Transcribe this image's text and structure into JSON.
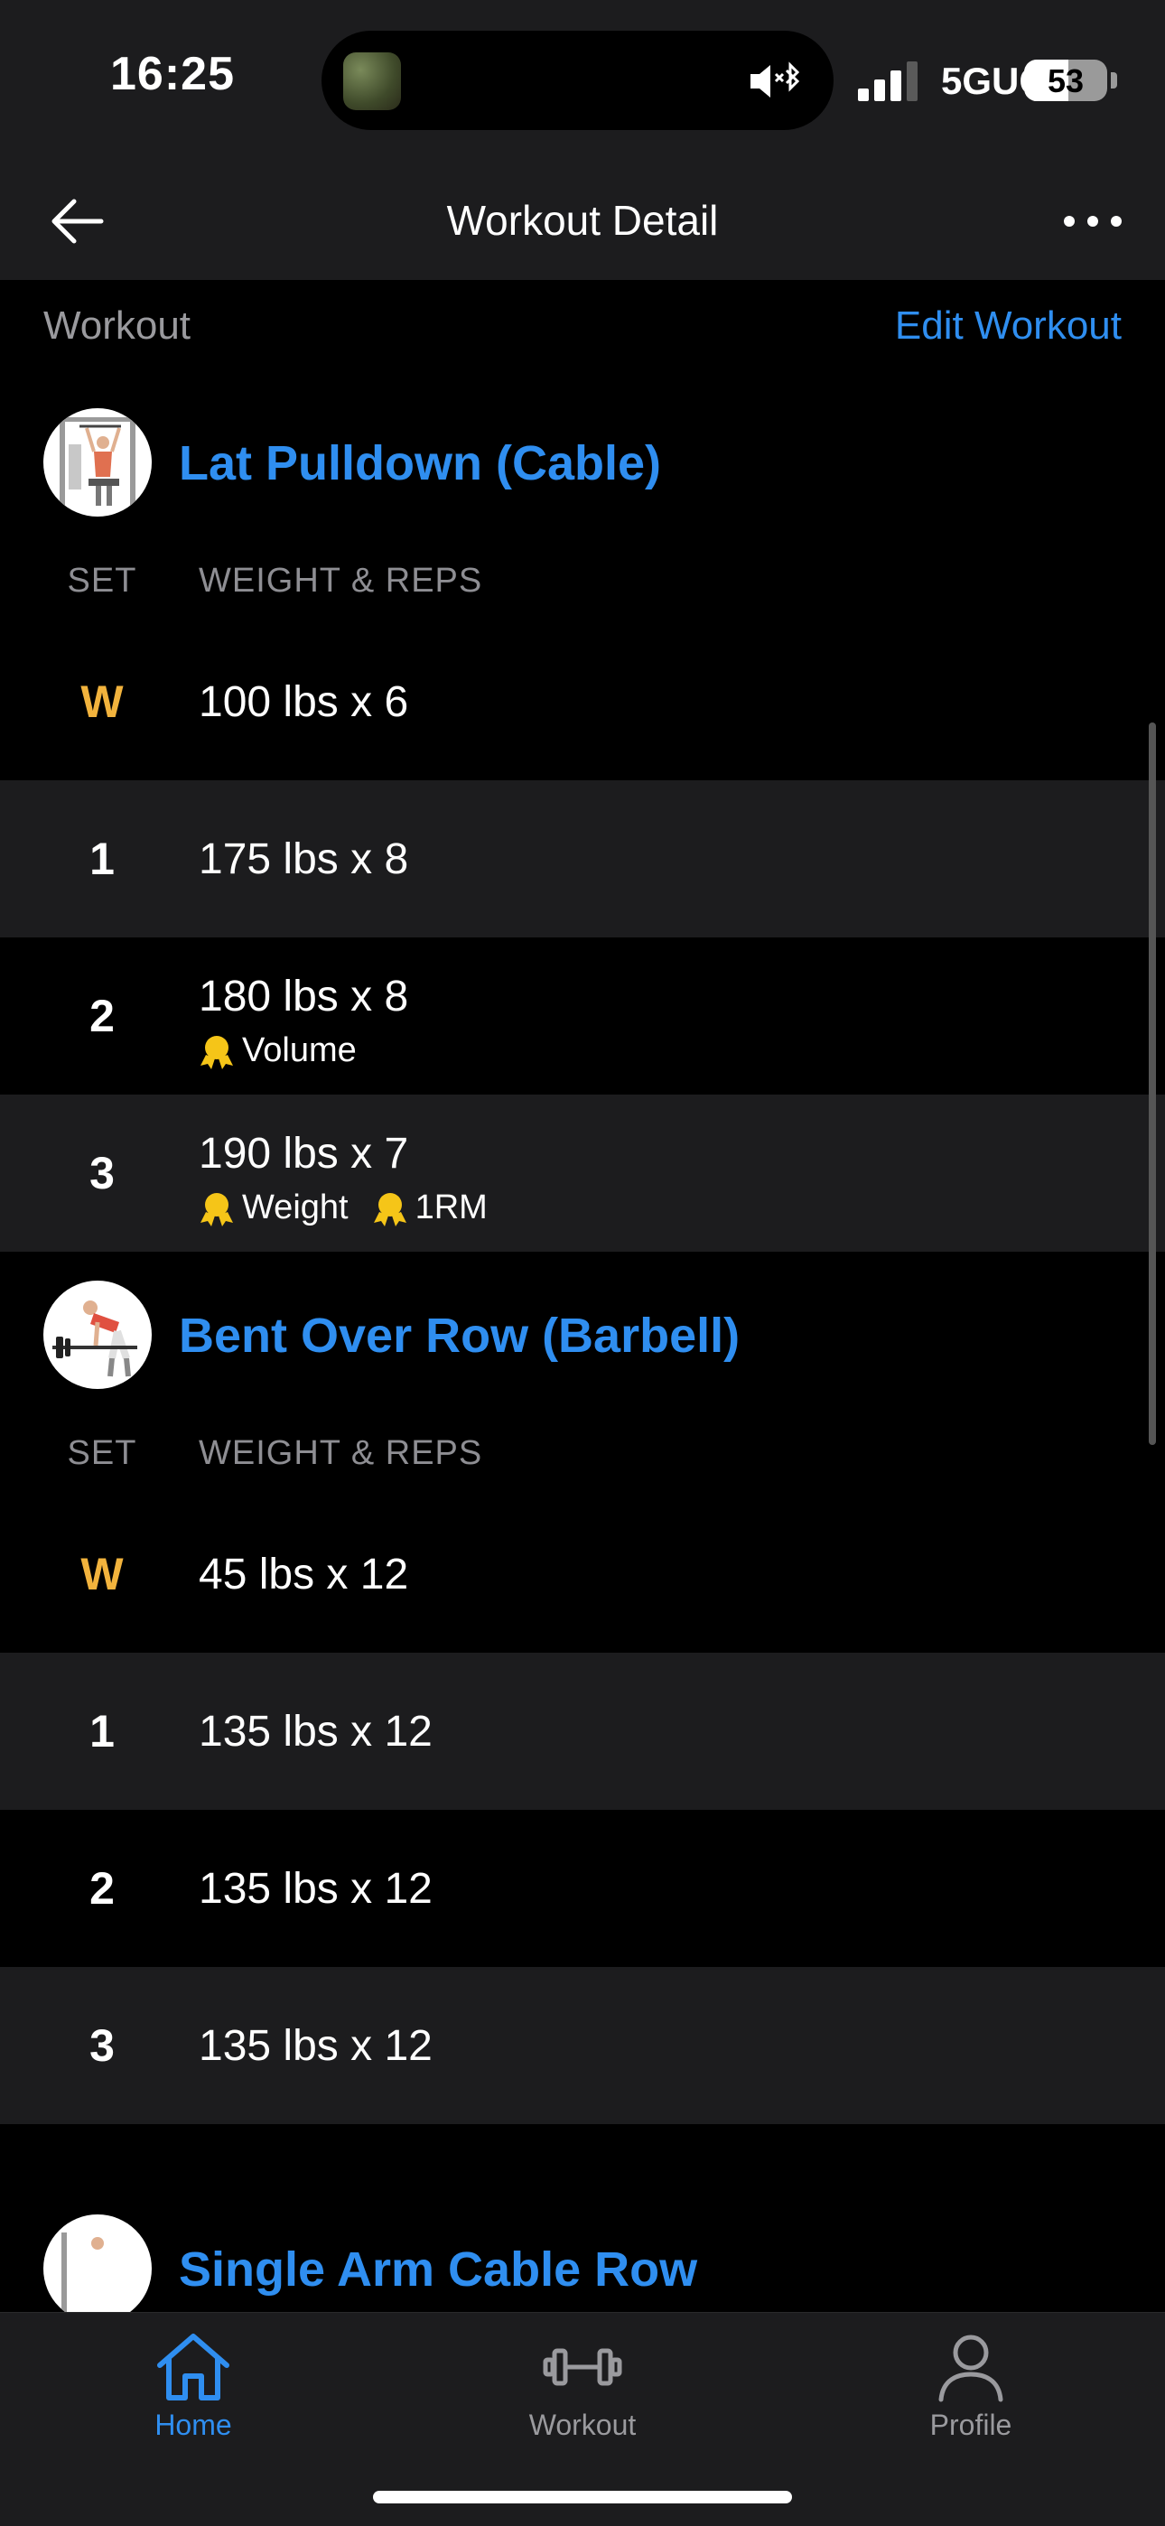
{
  "status_bar": {
    "time": "16:25",
    "network": "5GUC",
    "battery": "53",
    "battery_level": 0.53
  },
  "nav": {
    "title": "Workout Detail"
  },
  "workout": {
    "section_label": "Workout",
    "edit_label": "Edit Workout"
  },
  "columns": {
    "set": "SET",
    "weight_reps": "WEIGHT & REPS"
  },
  "exercises": [
    {
      "name": "Lat Pulldown (Cable)",
      "sets": [
        {
          "set": "W",
          "value": "100 lbs x 6",
          "badges": []
        },
        {
          "set": "1",
          "value": "175 lbs x 8",
          "badges": []
        },
        {
          "set": "2",
          "value": "180 lbs x 8",
          "badges": [
            "Volume"
          ]
        },
        {
          "set": "3",
          "value": "190 lbs x 7",
          "badges": [
            "Weight",
            "1RM"
          ]
        }
      ]
    },
    {
      "name": "Bent Over Row (Barbell)",
      "sets": [
        {
          "set": "W",
          "value": "45 lbs x 12",
          "badges": []
        },
        {
          "set": "1",
          "value": "135 lbs x 12",
          "badges": []
        },
        {
          "set": "2",
          "value": "135 lbs x 12",
          "badges": []
        },
        {
          "set": "3",
          "value": "135 lbs x 12",
          "badges": []
        }
      ]
    },
    {
      "name": "Single Arm Cable Row",
      "sets": []
    }
  ],
  "tabs": [
    {
      "label": "Home",
      "icon": "home-icon",
      "active": true
    },
    {
      "label": "Workout",
      "icon": "dumbbell-icon",
      "active": false
    },
    {
      "label": "Profile",
      "icon": "person-icon",
      "active": false
    }
  ],
  "colors": {
    "accent": "#2f8ef0",
    "warmup": "#f2b33d",
    "medal": "#f5c518"
  }
}
